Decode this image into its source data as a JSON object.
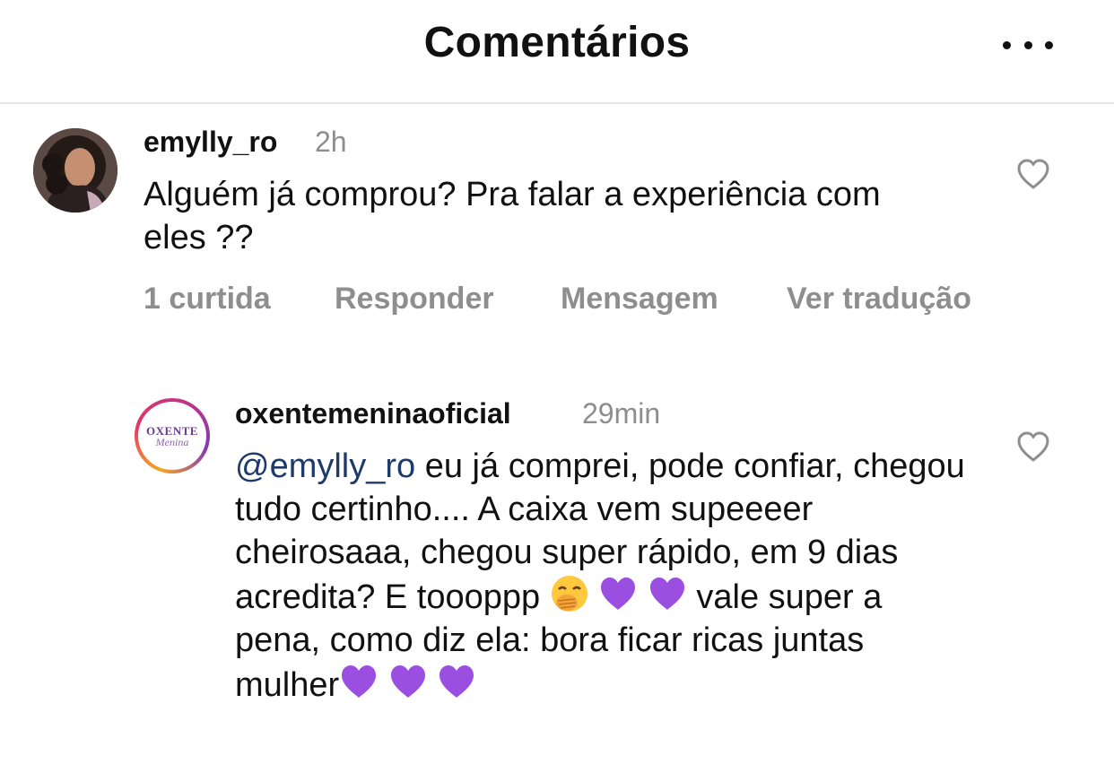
{
  "header": {
    "title": "Comentários",
    "more_icon": "more-horizontal-icon"
  },
  "comment": {
    "username": "emylly_ro",
    "time": "2h",
    "text": "Alguém já comprou? Pra falar a experiência com eles ??",
    "likes": "1 curtida",
    "reply_label": "Responder",
    "message_label": "Mensagem",
    "translate_label": "Ver tradução",
    "like_icon": "heart-outline-icon"
  },
  "reply": {
    "username": "oxentemeninaoficial",
    "time": "29min",
    "mention": "@emylly_ro",
    "text_part1": " eu já comprei, pode confiar, chegou tudo certinho.... A caixa vem supeeeer cheirosaaa, chegou super rápido, em 9 dias acredita? E toooppp ",
    "text_part2": " vale super a pena, como diz ela: bora ficar ricas juntas mulher",
    "avatar_logo_top": "OXENTE",
    "avatar_logo_bottom": "Menina",
    "like_icon": "heart-outline-icon",
    "emojis": [
      "hand-over-mouth-emoji",
      "purple-heart-emoji"
    ]
  },
  "colors": {
    "text": "#111111",
    "muted": "#8e8e8e",
    "mention": "#1d3a6b",
    "purple_heart": "#9b4fe0",
    "divider": "#e6e6e6"
  }
}
